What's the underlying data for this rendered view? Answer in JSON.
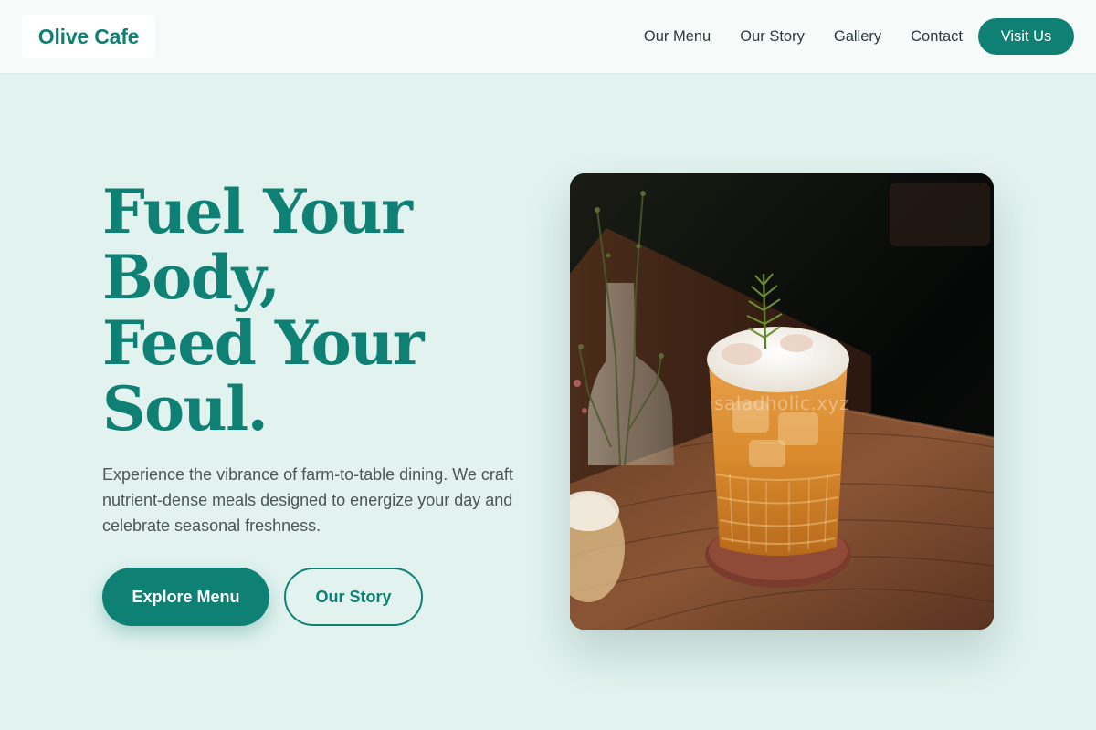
{
  "header": {
    "brand": "Olive Cafe",
    "nav": [
      "Our Menu",
      "Our Story",
      "Gallery",
      "Contact"
    ],
    "cta": "Visit Us"
  },
  "hero": {
    "title_lines": [
      "Fuel Your",
      "Body,",
      "Feed Your",
      "Soul."
    ],
    "description": "Experience the vibrance of farm-to-table dining. We craft nutrient-dense meals designed to energize your day and celebrate seasonal freshness.",
    "primary_button": "Explore Menu",
    "secondary_button": "Our Story",
    "image_watermark": "saladholic.xyz"
  },
  "colors": {
    "brand": "#0f8174",
    "page_bg": "#e1f2ef",
    "nav_bg": "#f6fbfa",
    "body_text": "#4b5656"
  }
}
